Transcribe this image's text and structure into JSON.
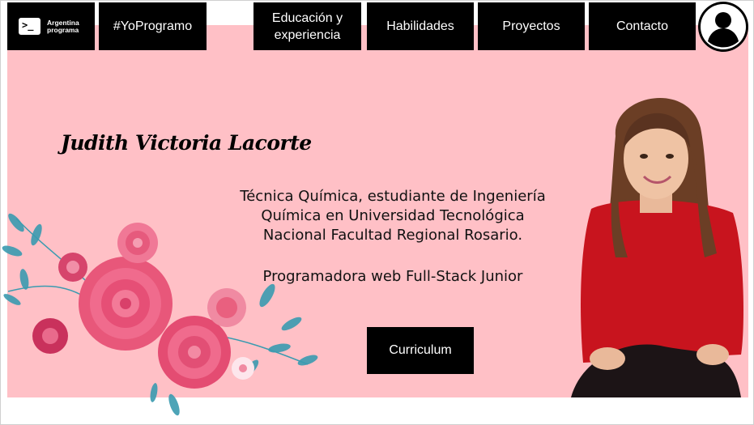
{
  "brand": {
    "logo_line1": "Argentina",
    "logo_line2": "programa",
    "logo_icon": "terminal-prompt-icon"
  },
  "nav": {
    "hashtag": "#YoProgramo",
    "items": [
      {
        "label": "Educación y experiencia"
      },
      {
        "label": "Habilidades"
      },
      {
        "label": "Proyectos"
      },
      {
        "label": "Contacto"
      }
    ],
    "avatar_icon": "user-avatar-icon"
  },
  "hero": {
    "name": "Judith Victoria Lacorte",
    "description_lines": [
      "Técnica Química, estudiante de Ingeniería",
      "Química en Universidad Tecnológica",
      "Nacional Facultad Regional Rosario."
    ],
    "role": "Programadora web Full-Stack Junior",
    "cv_button": "Curriculum"
  },
  "colors": {
    "hero_bg": "#ffc0c6",
    "nav_bg": "#000000",
    "nav_text": "#ffffff",
    "accent_red": "#c8141e"
  }
}
